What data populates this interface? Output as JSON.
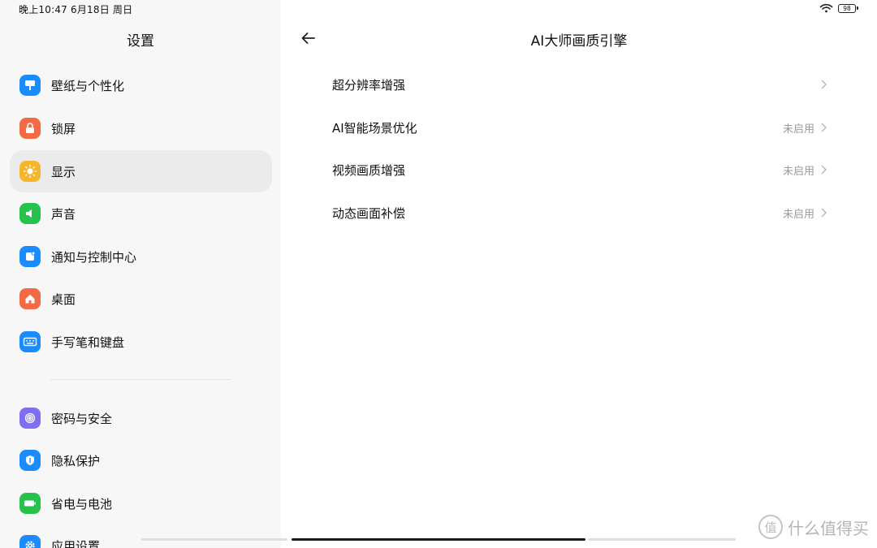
{
  "status_bar": {
    "time": "晚上10:47 6月18日 周日",
    "battery": "98"
  },
  "left_pane": {
    "title": "设置",
    "items": [
      {
        "label": "壁纸与个性化",
        "icon": "wallpaper-icon",
        "color": "#1a8cff"
      },
      {
        "label": "锁屏",
        "icon": "lock-icon",
        "color": "#f46a45"
      },
      {
        "label": "显示",
        "icon": "display-sun-icon",
        "color": "#f7b52c",
        "active": true
      },
      {
        "label": "声音",
        "icon": "speaker-icon",
        "color": "#27c24c"
      },
      {
        "label": "通知与控制中心",
        "icon": "notification-icon",
        "color": "#1a8cff"
      },
      {
        "label": "桌面",
        "icon": "home-icon",
        "color": "#f46a45"
      },
      {
        "label": "手写笔和键盘",
        "icon": "keyboard-icon",
        "color": "#1a8cff"
      },
      {
        "label": "密码与安全",
        "icon": "fingerprint-icon",
        "color": "#7e6ff0"
      },
      {
        "label": "隐私保护",
        "icon": "privacy-shield-icon",
        "color": "#1a8cff"
      },
      {
        "label": "省电与电池",
        "icon": "battery-icon",
        "color": "#27c24c"
      },
      {
        "label": "应用设置",
        "icon": "gear-icon",
        "color": "#1a8cff"
      }
    ]
  },
  "right_pane": {
    "title": "AI大师画质引擎",
    "options": [
      {
        "label": "超分辨率增强",
        "status": ""
      },
      {
        "label": "AI智能场景优化",
        "status": "未启用"
      },
      {
        "label": "视频画质增强",
        "status": "未启用"
      },
      {
        "label": "动态画面补偿",
        "status": "未启用"
      }
    ]
  },
  "watermark": {
    "logo": "值",
    "text": "什么值得买"
  }
}
